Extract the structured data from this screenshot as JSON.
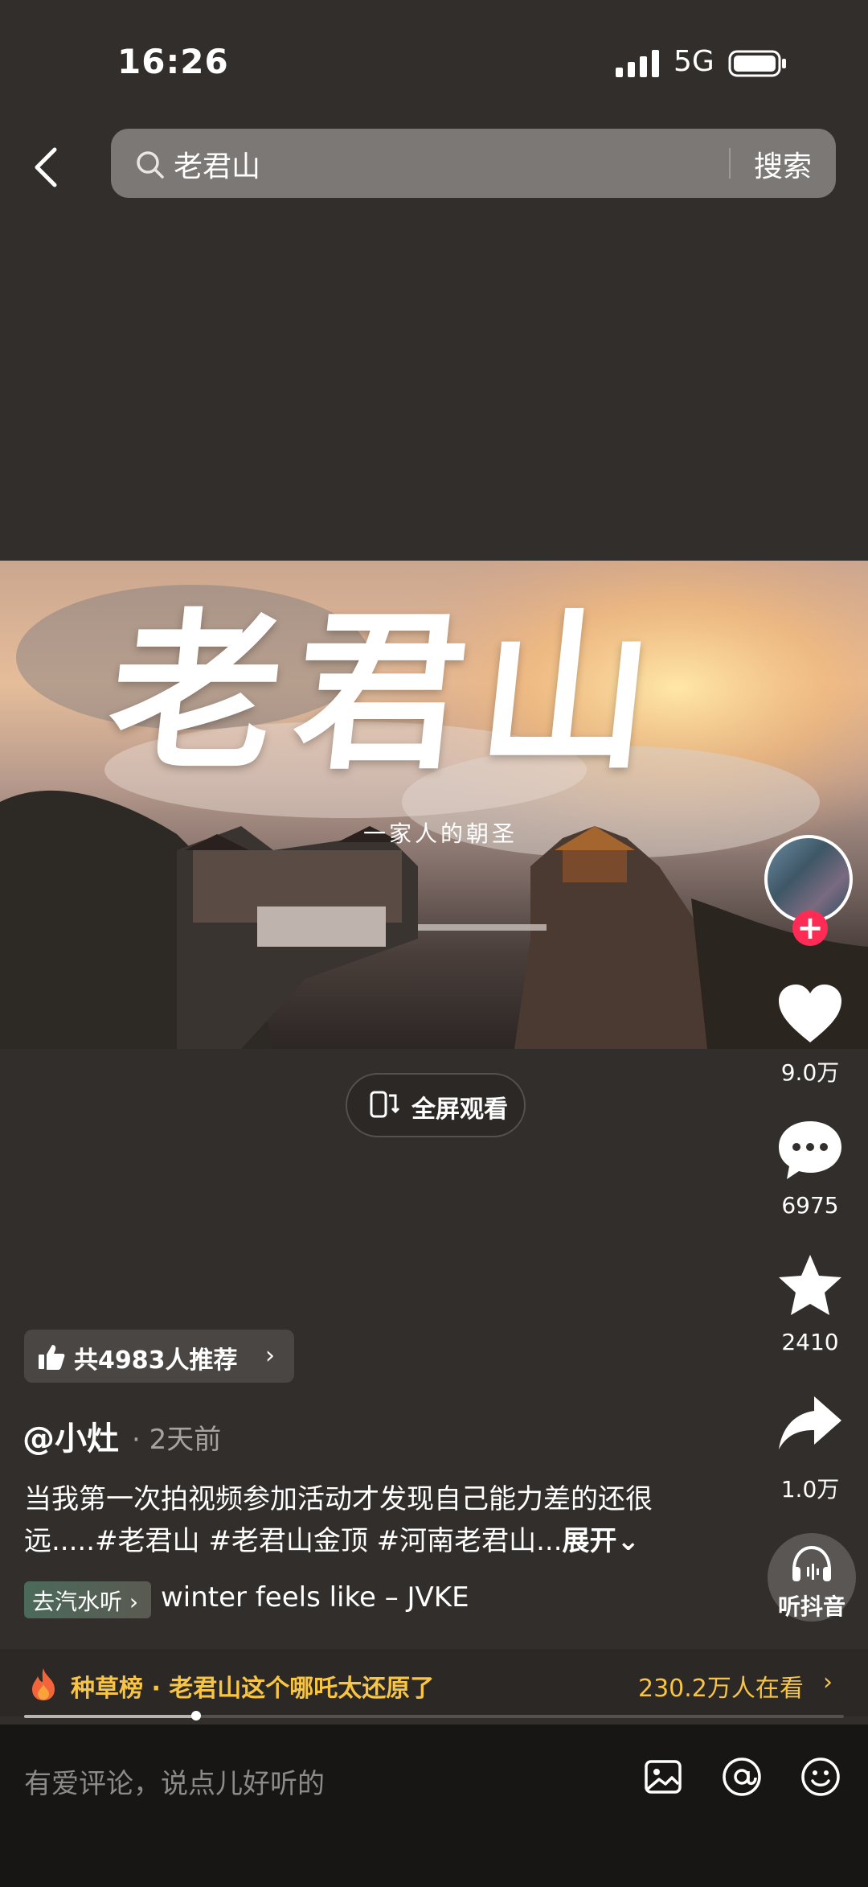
{
  "status_bar": {
    "time": "16:26",
    "network": "5G",
    "icons": [
      "signal-icon",
      "battery-icon"
    ]
  },
  "header": {
    "search_query": "老君山",
    "search_button": "搜索"
  },
  "video": {
    "title_art": "老君山",
    "subtitle_art": "一家人的朝圣",
    "fullscreen_label": "全屏观看"
  },
  "actions": {
    "like_count": "9.0万",
    "comment_count": "6975",
    "favorite_count": "2410",
    "share_count": "1.0万",
    "listen_label": "听抖音"
  },
  "post": {
    "recommend": "共4983人推荐",
    "author": "@小灶",
    "time_ago": "· 2天前",
    "description": "当我第一次拍视频参加活动才发现自己能力差的还很远.....#老君山 #老君山金顶 #河南老君山...",
    "expand_label": "展开",
    "music_tag": "去汽水听",
    "music_title": "winter feels like – JVKE"
  },
  "trending": {
    "text": "种草榜 · 老君山这个哪吒太还原了",
    "viewers": "230.2万人在看",
    "progress": 0.21
  },
  "comment_bar": {
    "placeholder": "有爱评论，说点儿好听的",
    "icons": [
      "image-icon",
      "at-icon",
      "emoji-icon"
    ]
  },
  "colors": {
    "background": "#312e2b",
    "accent_yellow": "#f7c543",
    "follow_red": "#fe2c55"
  }
}
